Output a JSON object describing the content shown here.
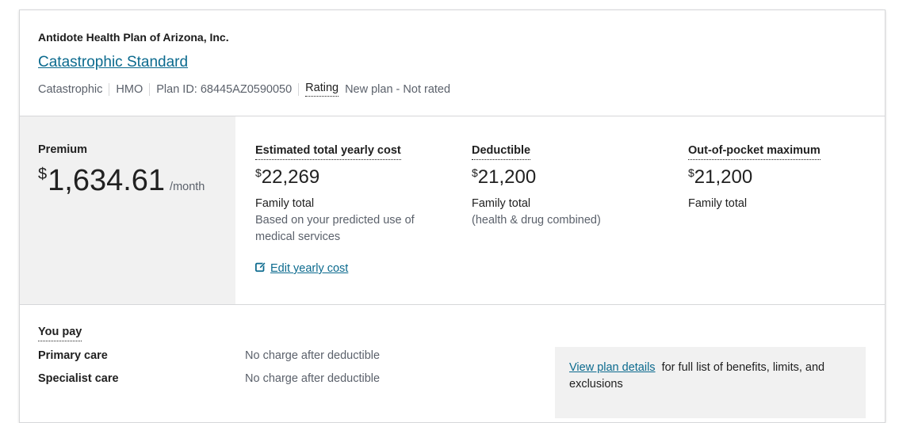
{
  "plan": {
    "issuer": "Antidote Health Plan of Arizona, Inc.",
    "name": "Catastrophic Standard",
    "metal_level": "Catastrophic",
    "type": "HMO",
    "plan_id": "Plan ID: 68445AZ0590050",
    "rating_label": "Rating",
    "rating_value": "New plan - Not rated"
  },
  "premium": {
    "label": "Premium",
    "currency": "$",
    "amount": "1,634.61",
    "period": "/month"
  },
  "yearly_cost": {
    "label": "Estimated total yearly cost",
    "currency": "$",
    "amount": "22,269",
    "sub": "Family total",
    "note": "Based on your predicted use of medical services",
    "edit_link": "Edit yearly cost"
  },
  "deductible": {
    "label": "Deductible",
    "currency": "$",
    "amount": "21,200",
    "sub": "Family total",
    "note": "(health & drug combined)"
  },
  "oop_max": {
    "label": "Out-of-pocket maximum",
    "currency": "$",
    "amount": "21,200",
    "sub": "Family total"
  },
  "you_pay": {
    "label": "You pay",
    "rows": [
      {
        "name": "Primary care",
        "value": "No charge after deductible"
      },
      {
        "name": "Specialist care",
        "value": "No charge after deductible"
      }
    ]
  },
  "details": {
    "link": "View plan details",
    "text": "for full list of benefits, limits, and exclusions"
  },
  "icons": {
    "edit": "edit-icon"
  },
  "colors": {
    "link": "#0b6a8e",
    "muted": "#5b616b",
    "panel": "#f1f1f1"
  }
}
